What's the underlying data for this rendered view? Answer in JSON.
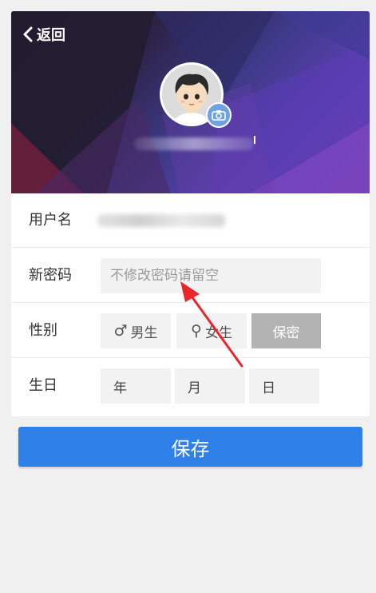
{
  "header": {
    "back_label": "返回",
    "back_icon": "chevron-left-icon",
    "avatar_icon": "avatar-cartoon",
    "camera_icon": "camera-icon"
  },
  "form": {
    "username": {
      "label": "用户名"
    },
    "password": {
      "label": "新密码",
      "placeholder": "不修改密码请留空",
      "value": ""
    },
    "gender": {
      "label": "性别",
      "options": [
        {
          "label": "男生",
          "symbol": "♂"
        },
        {
          "label": "女生",
          "symbol": "⚲"
        },
        {
          "label": "保密",
          "symbol": ""
        }
      ],
      "selected": "保密"
    },
    "birthday": {
      "label": "生日",
      "year_placeholder": "年",
      "month_placeholder": "月",
      "day_placeholder": "日"
    }
  },
  "actions": {
    "save_label": "保存"
  },
  "colors": {
    "accent": "#2f80e8",
    "selected_chip": "#b3b3b3",
    "annotation_arrow": "#e8262b"
  }
}
